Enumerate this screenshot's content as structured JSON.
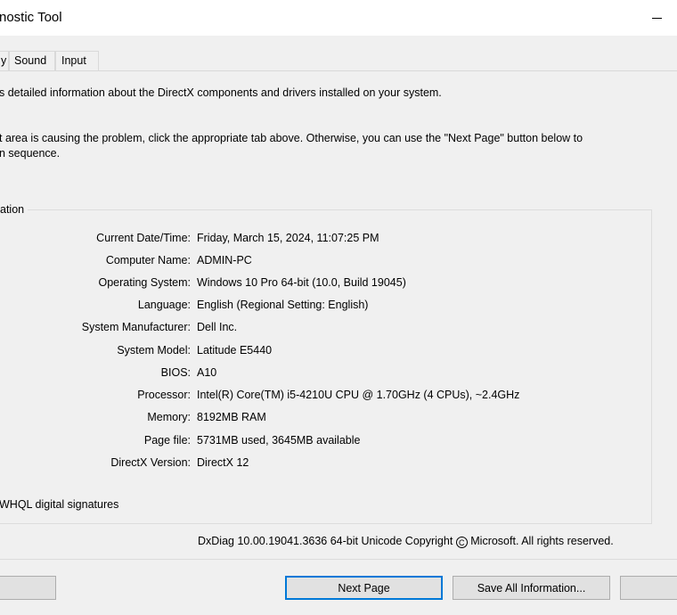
{
  "window": {
    "title": "nostic Tool"
  },
  "tabs": [
    {
      "label": "y"
    },
    {
      "label": "Sound"
    },
    {
      "label": "Input"
    }
  ],
  "intro": {
    "line1": "s detailed information about the DirectX components and drivers installed on your system.",
    "line2": "t area is causing the problem, click the appropriate tab above.  Otherwise, you can use the \"Next Page\" button below to",
    "line3": "n sequence."
  },
  "system_info": {
    "group_label": "ation",
    "rows": [
      {
        "label": "Current Date/Time:",
        "value": "Friday, March 15, 2024, 11:07:25 PM"
      },
      {
        "label": "Computer Name:",
        "value": "ADMIN-PC"
      },
      {
        "label": "Operating System:",
        "value": "Windows 10 Pro 64-bit (10.0, Build 19045)"
      },
      {
        "label": "Language:",
        "value": "English (Regional Setting: English)"
      },
      {
        "label": "System Manufacturer:",
        "value": "Dell Inc."
      },
      {
        "label": "System Model:",
        "value": "Latitude E5440"
      },
      {
        "label": "BIOS:",
        "value": "A10"
      },
      {
        "label": "Processor:",
        "value": "Intel(R) Core(TM) i5-4210U CPU @ 1.70GHz (4 CPUs), ~2.4GHz"
      },
      {
        "label": "Memory:",
        "value": "8192MB RAM"
      },
      {
        "label": "Page file:",
        "value": "5731MB used, 3645MB available"
      },
      {
        "label": "DirectX Version:",
        "value": "DirectX 12"
      }
    ],
    "whql_label": "WHQL digital signatures"
  },
  "footer": {
    "version_text": "DxDiag 10.00.19041.3636 64-bit Unicode  Copyright ",
    "copyright_symbol": "C",
    "rights_text": " Microsoft. All rights reserved."
  },
  "buttons": {
    "next_page": "Next Page",
    "save_all": "Save All Information..."
  }
}
